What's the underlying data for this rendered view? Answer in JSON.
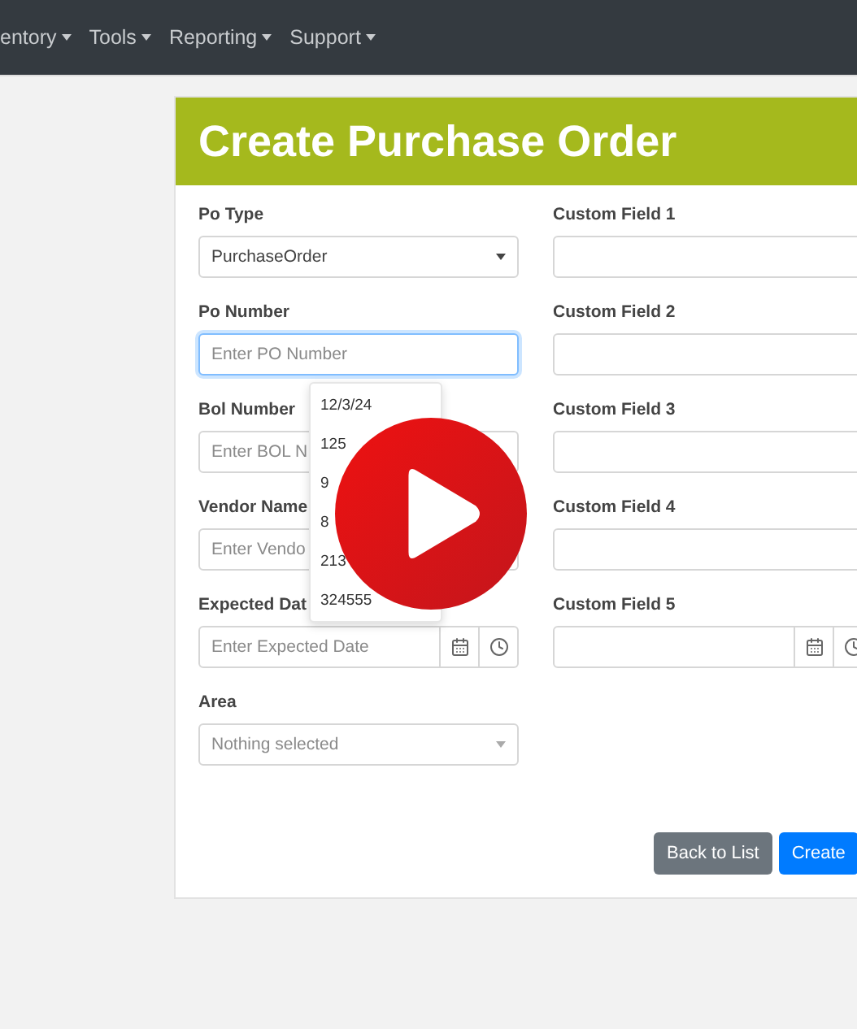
{
  "navbar": {
    "menus": [
      {
        "label": "entory"
      },
      {
        "label": "Tools"
      },
      {
        "label": "Reporting"
      },
      {
        "label": "Support"
      }
    ]
  },
  "form": {
    "title": "Create Purchase Order",
    "left_fields": [
      {
        "label": "Po Type",
        "kind": "select",
        "value": "PurchaseOrder",
        "focused": false
      },
      {
        "label": "Po Number",
        "kind": "text",
        "placeholder": "Enter PO Number",
        "focused": true
      },
      {
        "label": "Bol Number",
        "kind": "text",
        "placeholder": "Enter BOL N",
        "focused": false
      },
      {
        "label": "Vendor Name",
        "kind": "text",
        "placeholder": "Enter Vendo",
        "focused": false
      },
      {
        "label": "Expected Dat",
        "kind": "datetime",
        "placeholder": "Enter Expected Date",
        "focused": false
      },
      {
        "label": "Area",
        "kind": "select",
        "placeholder": "Nothing selected",
        "focused": false
      }
    ],
    "right_fields": [
      {
        "label": "Custom Field 1",
        "kind": "text",
        "focused": false
      },
      {
        "label": "Custom Field 2",
        "kind": "text",
        "focused": false
      },
      {
        "label": "Custom Field 3",
        "kind": "text",
        "focused": false
      },
      {
        "label": "Custom Field 4",
        "kind": "text",
        "focused": false
      },
      {
        "label": "Custom Field 5",
        "kind": "datetime",
        "focused": false
      }
    ],
    "suggestions": [
      "12/3/24",
      "125",
      "9",
      "8",
      "213",
      "324555"
    ],
    "buttons": [
      {
        "label": "Back to List",
        "kind": "secondary"
      },
      {
        "label": "Create",
        "kind": "primary"
      }
    ]
  }
}
